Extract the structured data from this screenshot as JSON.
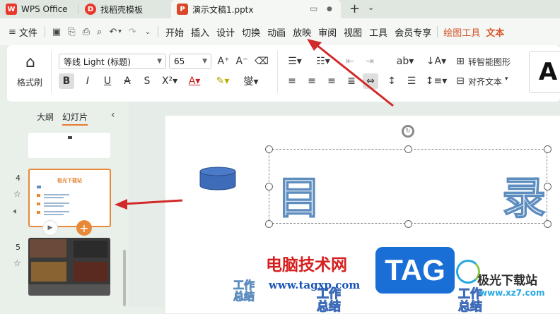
{
  "tabs": [
    {
      "label": "WPS Office",
      "logo": "W"
    },
    {
      "label": "找稻壳模板",
      "logo": "D"
    },
    {
      "label": "演示文稿1.pptx",
      "logo": "P"
    }
  ],
  "menu": {
    "file_label": "文件",
    "items": [
      "开始",
      "插入",
      "设计",
      "切换",
      "动画",
      "放映",
      "审阅",
      "视图",
      "工具",
      "会员专享",
      "绘图工具",
      "文本"
    ]
  },
  "ribbon": {
    "format_painter_label": "格式刷",
    "font_name": "等线 Light (标题)",
    "font_size": "65",
    "smart_shape_label": "转智能图形",
    "align_text_label": "对齐文本",
    "big_a": "A"
  },
  "left_panel": {
    "outline_tab": "大纲",
    "slides_tab": "幻灯片",
    "slide_numbers": [
      "4",
      "5"
    ],
    "slide4_title": "极光下载站"
  },
  "slide": {
    "title_left": "目",
    "title_right": "录",
    "sub_texts": [
      "工作",
      "总结",
      "工作",
      "总结",
      "工作",
      "总结"
    ]
  },
  "watermark": {
    "site_name": "电脑技术网",
    "site_url": "www.tagxp.com",
    "badge": "TAG",
    "brand": "极光下载站",
    "brand_url": "www.xz7.com"
  },
  "colors": {
    "accent_orange": "#e8893a",
    "arrow_red": "#d12a2a",
    "tag_blue": "#1a6fd6"
  }
}
